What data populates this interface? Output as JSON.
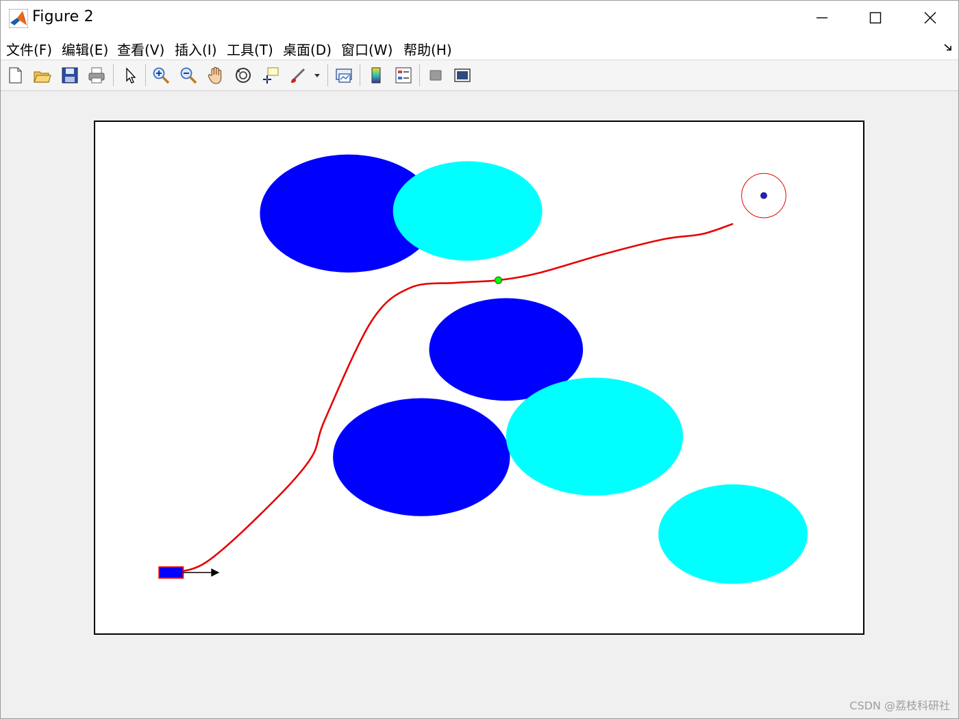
{
  "window": {
    "title": "Figure 2",
    "controls": {
      "minimize": "minimize",
      "maximize": "maximize",
      "close": "close"
    }
  },
  "menu": {
    "items": [
      "文件(F)",
      "编辑(E)",
      "查看(V)",
      "插入(I)",
      "工具(T)",
      "桌面(D)",
      "窗口(W)",
      "帮助(H)"
    ]
  },
  "toolbar": {
    "buttons": [
      {
        "name": "new-figure-icon"
      },
      {
        "name": "open-file-icon"
      },
      {
        "name": "save-icon"
      },
      {
        "name": "print-icon"
      },
      {
        "name": "edit-plot-arrow-icon"
      },
      {
        "name": "zoom-in-icon"
      },
      {
        "name": "zoom-out-icon"
      },
      {
        "name": "pan-hand-icon"
      },
      {
        "name": "rotate-3d-icon"
      },
      {
        "name": "data-cursor-icon"
      },
      {
        "name": "brush-icon"
      },
      {
        "name": "link-plot-icon"
      },
      {
        "name": "insert-colorbar-icon"
      },
      {
        "name": "insert-legend-icon"
      },
      {
        "name": "hide-plot-tools-icon"
      },
      {
        "name": "show-plot-tools-icon"
      }
    ]
  },
  "plot": {
    "obstacles": [
      {
        "cx": 3.3,
        "cy": 8.2,
        "r": 1.15,
        "color": "#0000ff"
      },
      {
        "cx": 4.85,
        "cy": 8.25,
        "r": 0.97,
        "color": "#00ffff"
      },
      {
        "cx": 5.35,
        "cy": 5.55,
        "r": 1.0,
        "color": "#0000ff"
      },
      {
        "cx": 4.25,
        "cy": 3.45,
        "r": 1.15,
        "color": "#0000ff"
      },
      {
        "cx": 6.5,
        "cy": 3.85,
        "r": 1.15,
        "color": "#00ffff"
      },
      {
        "cx": 8.3,
        "cy": 1.95,
        "r": 0.97,
        "color": "#00ffff"
      }
    ],
    "path": [
      [
        1.0,
        1.2
      ],
      [
        1.45,
        1.4
      ],
      [
        2.2,
        2.4
      ],
      [
        2.8,
        3.4
      ],
      [
        3.0,
        4.2
      ],
      [
        3.6,
        6.1
      ],
      [
        4.1,
        6.75
      ],
      [
        4.7,
        6.85
      ],
      [
        5.25,
        6.9
      ],
      [
        5.8,
        7.05
      ],
      [
        6.6,
        7.4
      ],
      [
        7.4,
        7.7
      ],
      [
        7.9,
        7.8
      ],
      [
        8.3,
        8.0
      ]
    ],
    "path_color": "#e60000",
    "waypoint": {
      "x": 5.25,
      "y": 6.9,
      "color": "#00ff00"
    },
    "goal": {
      "x": 8.7,
      "y": 8.55,
      "radius": 0.4,
      "ring_color": "#e60000",
      "dot_color": "#2222aa"
    },
    "vehicle": {
      "x": 1.0,
      "y": 1.2,
      "body_color": "#0000ff",
      "outline_color": "#e60000"
    },
    "xlim": [
      0,
      10
    ],
    "ylim": [
      0,
      10
    ]
  },
  "watermark": "CSDN @荔枝科研社"
}
